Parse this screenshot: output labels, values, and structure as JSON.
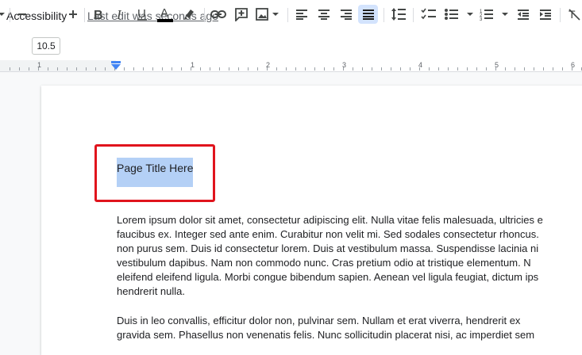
{
  "menubar": {
    "accessibility_label": "Accessibility",
    "last_edit": "Last edit was seconds ago"
  },
  "toolbar": {
    "font_size": "10.5",
    "icons": [
      "chevron-down-icon",
      "minus-icon",
      "plus-icon",
      "bold-icon",
      "italic-icon",
      "underline-icon",
      "text-color-icon",
      "highlight-icon",
      "link-icon",
      "comment-icon",
      "image-icon",
      "align-left-icon",
      "align-center-icon",
      "align-right-icon",
      "align-justify-icon",
      "line-spacing-icon",
      "checklist-icon",
      "bulleted-list-icon",
      "numbered-list-icon",
      "decrease-indent-icon",
      "increase-indent-icon",
      "clear-formatting-icon"
    ],
    "active_tool": "align-justify"
  },
  "ruler": {
    "numbers": [
      "1",
      "1",
      "2",
      "3",
      "4",
      "5",
      "6"
    ]
  },
  "document": {
    "title": "Page Title Here",
    "paragraph1": [
      "Lorem ipsum dolor sit amet, consectetur adipiscing elit. Nulla vitae felis malesuada, ultricies e",
      "faucibus ex. Integer sed ante enim. Curabitur non velit mi. Sed sodales consectetur rhoncus.",
      "non purus sem. Duis id consectetur lorem. Duis at vestibulum massa. Suspendisse lacinia ni",
      "vestibulum dapibus. Nam non commodo nunc. Cras pretium odio at tristique elementum. N",
      "eleifend eleifend ligula. Morbi congue bibendum sapien. Aenean vel ligula feugiat, dictum ips",
      "hendrerit nulla."
    ],
    "paragraph2": [
      "Duis in leo convallis, efficitur dolor non, pulvinar sem. Nullam et erat viverra, hendrerit ex",
      "gravida sem. Phasellus non venenatis felis. Nunc sollicitudin placerat nisi, ac imperdiet sem"
    ]
  },
  "colors": {
    "selection": "#b4d0f6",
    "annotation_box": "#e0141d",
    "active_button": "#d3e3fd",
    "indent_marker": "#4285f4"
  }
}
